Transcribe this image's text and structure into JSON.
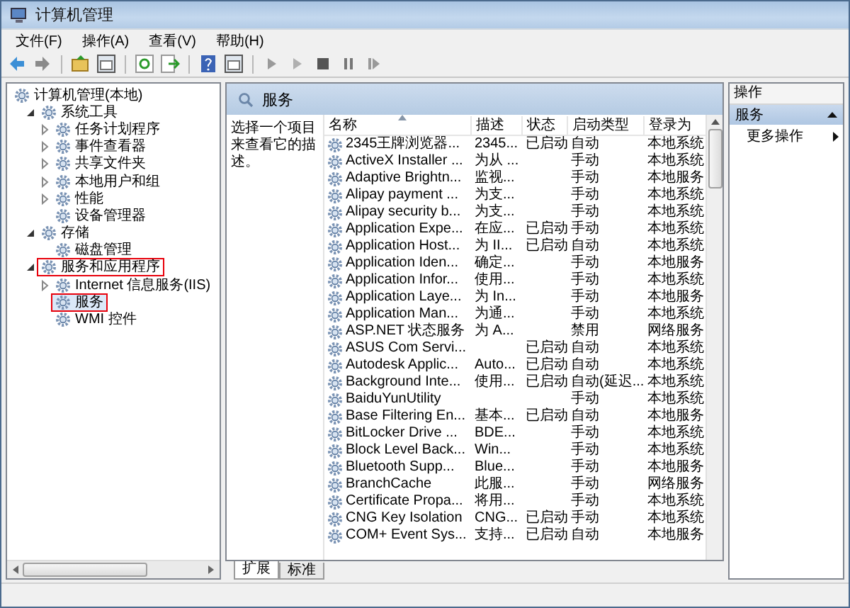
{
  "window": {
    "title": "计算机管理"
  },
  "menu": [
    "文件(F)",
    "操作(A)",
    "查看(V)",
    "帮助(H)"
  ],
  "tree": {
    "label": "计算机管理(本地)",
    "selected": false,
    "highlighted": false,
    "children": [
      {
        "label": "系统工具",
        "expanded": true,
        "selected": false,
        "highlighted": false,
        "children": [
          {
            "label": "任务计划程序",
            "expanded": false,
            "selected": false,
            "highlighted": false
          },
          {
            "label": "事件查看器",
            "expanded": false,
            "selected": false,
            "highlighted": false
          },
          {
            "label": "共享文件夹",
            "expanded": false,
            "selected": false,
            "highlighted": false
          },
          {
            "label": "本地用户和组",
            "expanded": false,
            "selected": false,
            "highlighted": false
          },
          {
            "label": "性能",
            "expanded": false,
            "selected": false,
            "highlighted": false
          },
          {
            "label": "设备管理器",
            "selected": false,
            "highlighted": false
          }
        ]
      },
      {
        "label": "存储",
        "expanded": true,
        "selected": false,
        "highlighted": false,
        "children": [
          {
            "label": "磁盘管理",
            "selected": false,
            "highlighted": false
          }
        ]
      },
      {
        "label": "服务和应用程序",
        "expanded": true,
        "selected": false,
        "highlighted": true,
        "children": [
          {
            "label": "Internet 信息服务(IIS)",
            "expanded": false,
            "selected": false,
            "highlighted": false
          },
          {
            "label": "服务",
            "selected": true,
            "highlighted": true
          },
          {
            "label": "WMI 控件",
            "selected": false,
            "highlighted": false
          }
        ]
      }
    ]
  },
  "panel": {
    "title": "服务",
    "description": "选择一个项目来查看它的描述。"
  },
  "table": {
    "columns": [
      {
        "label": "名称",
        "sorted": true
      },
      {
        "label": "描述",
        "sorted": false
      },
      {
        "label": "状态",
        "sorted": false
      },
      {
        "label": "启动类型",
        "sorted": false
      },
      {
        "label": "登录为",
        "sorted": false
      }
    ],
    "rows": [
      {
        "name": "2345王牌浏览器...",
        "description": "2345...",
        "status": "已启动",
        "startup": "自动",
        "logon": "本地系统"
      },
      {
        "name": "ActiveX Installer ...",
        "description": "为从 ...",
        "startup": "手动",
        "logon": "本地系统"
      },
      {
        "name": "Adaptive Brightn...",
        "description": "监视...",
        "startup": "手动",
        "logon": "本地服务"
      },
      {
        "name": "Alipay payment ...",
        "description": "为支...",
        "startup": "手动",
        "logon": "本地系统"
      },
      {
        "name": "Alipay security b...",
        "description": "为支...",
        "startup": "手动",
        "logon": "本地系统"
      },
      {
        "name": "Application Expe...",
        "description": "在应...",
        "status": "已启动",
        "startup": "手动",
        "logon": "本地系统"
      },
      {
        "name": "Application Host...",
        "description": "为 II...",
        "status": "已启动",
        "startup": "自动",
        "logon": "本地系统"
      },
      {
        "name": "Application Iden...",
        "description": "确定...",
        "startup": "手动",
        "logon": "本地服务"
      },
      {
        "name": "Application Infor...",
        "description": "使用...",
        "startup": "手动",
        "logon": "本地系统"
      },
      {
        "name": "Application Laye...",
        "description": "为 In...",
        "startup": "手动",
        "logon": "本地服务"
      },
      {
        "name": "Application Man...",
        "description": "为通...",
        "startup": "手动",
        "logon": "本地系统"
      },
      {
        "name": "ASP.NET 状态服务",
        "description": "为 A...",
        "startup": "禁用",
        "logon": "网络服务"
      },
      {
        "name": "ASUS Com Servi...",
        "status": "已启动",
        "startup": "自动",
        "logon": "本地系统"
      },
      {
        "name": "Autodesk Applic...",
        "description": "Auto...",
        "status": "已启动",
        "startup": "自动",
        "logon": "本地系统"
      },
      {
        "name": "Background Inte...",
        "description": "使用...",
        "status": "已启动",
        "startup": "自动(延迟...",
        "logon": "本地系统"
      },
      {
        "name": "BaiduYunUtility",
        "startup": "手动",
        "logon": "本地系统"
      },
      {
        "name": "Base Filtering En...",
        "description": "基本...",
        "status": "已启动",
        "startup": "自动",
        "logon": "本地服务"
      },
      {
        "name": "BitLocker Drive ...",
        "description": "BDE...",
        "startup": "手动",
        "logon": "本地系统"
      },
      {
        "name": "Block Level Back...",
        "description": "Win...",
        "startup": "手动",
        "logon": "本地系统"
      },
      {
        "name": "Bluetooth Supp...",
        "description": "Blue...",
        "startup": "手动",
        "logon": "本地服务"
      },
      {
        "name": "BranchCache",
        "description": "此服...",
        "startup": "手动",
        "logon": "网络服务"
      },
      {
        "name": "Certificate Propa...",
        "description": "将用...",
        "startup": "手动",
        "logon": "本地系统"
      },
      {
        "name": "CNG Key Isolation",
        "description": "CNG...",
        "status": "已启动",
        "startup": "手动",
        "logon": "本地系统"
      },
      {
        "name": "COM+ Event Sys...",
        "description": "支持...",
        "status": "已启动",
        "startup": "自动",
        "logon": "本地服务"
      }
    ]
  },
  "tabs": [
    {
      "label": "扩展",
      "selected": true
    },
    {
      "label": "标准",
      "selected": false
    }
  ],
  "actions": {
    "title": "操作",
    "section": "服务",
    "items": [
      "更多操作"
    ]
  }
}
